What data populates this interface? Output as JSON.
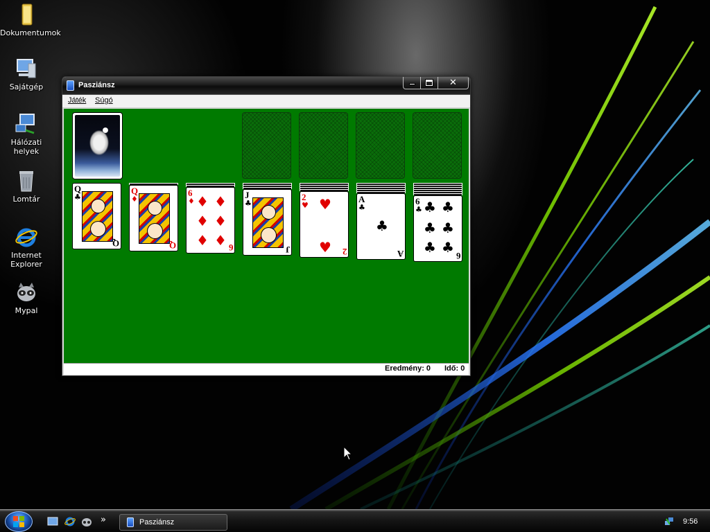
{
  "desktop": {
    "icons": [
      {
        "label": "Dokumentumok",
        "icon": "folder-icon"
      },
      {
        "label": "Sajátgép",
        "icon": "computer-icon"
      },
      {
        "label": "Hálózati helyek",
        "icon": "network-icon"
      },
      {
        "label": "Lomtár",
        "icon": "recycle-bin-icon"
      },
      {
        "label": "Internet Explorer",
        "icon": "internet-explorer-icon"
      },
      {
        "label": "Mypal",
        "icon": "mypal-icon"
      }
    ]
  },
  "window": {
    "title": "Pasziánsz",
    "menu": [
      "Játék",
      "Súgó"
    ],
    "status": {
      "score": "Eredmény: 0",
      "time": "Idő: 0"
    }
  },
  "game": {
    "stock": "face-down deck (astronaut back)",
    "foundations": [
      "empty",
      "empty",
      "empty",
      "empty"
    ],
    "tableau": [
      {
        "hidden": 0,
        "rank": "Q",
        "suit": "♣",
        "color": "black"
      },
      {
        "hidden": 1,
        "rank": "Q",
        "suit": "♦",
        "color": "red"
      },
      {
        "hidden": 2,
        "rank": "6",
        "suit": "♦",
        "color": "red"
      },
      {
        "hidden": 3,
        "rank": "J",
        "suit": "♣",
        "color": "black"
      },
      {
        "hidden": 4,
        "rank": "2",
        "suit": "♥",
        "color": "red"
      },
      {
        "hidden": 5,
        "rank": "A",
        "suit": "♣",
        "color": "black"
      },
      {
        "hidden": 6,
        "rank": "6",
        "suit": "♣",
        "color": "black"
      }
    ]
  },
  "taskbar": {
    "task_label": "Pasziánsz",
    "overflow": "»",
    "clock": "9:56"
  },
  "colors": {
    "felt": "#007a00",
    "red_suit": "#e00000"
  }
}
